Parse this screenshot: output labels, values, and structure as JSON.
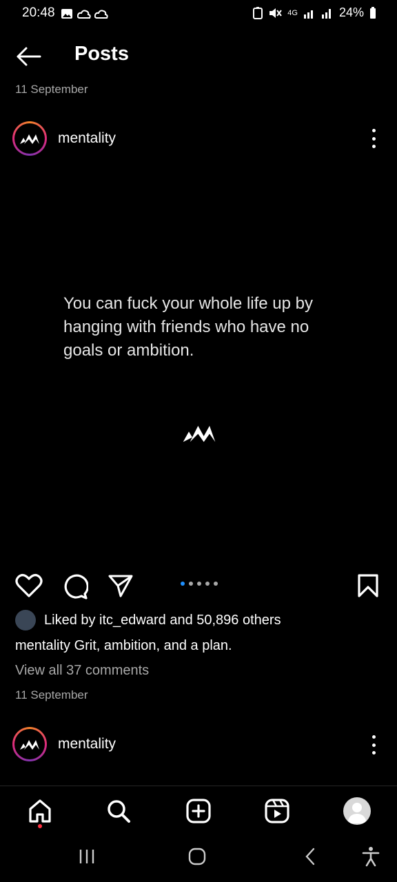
{
  "status_bar": {
    "time": "20:48",
    "network": "4G",
    "battery": "24%",
    "icons": [
      "image-icon",
      "cloud-icon",
      "cloud-icon",
      "battery-saver-icon",
      "mute-icon",
      "signal-icon",
      "signal-icon",
      "battery-icon"
    ]
  },
  "header": {
    "title": "Posts",
    "back_icon": "arrow-left-icon"
  },
  "posts": [
    {
      "date": "11 September",
      "username": "mentality",
      "quote": "You can fuck your whole life up by hanging with friends who have no goals or ambition.",
      "carousel": {
        "count": 5,
        "active_index": 0
      },
      "likes_text": "Liked by itc_edward and 50,896 others",
      "caption_user": "mentality",
      "caption_text": "Grit, ambition, and a plan.",
      "comments_link": "View all 37 comments",
      "footer_date": "11 September"
    },
    {
      "username": "mentality"
    }
  ],
  "bottom_nav": [
    "home-icon",
    "search-icon",
    "create-icon",
    "reels-icon",
    "profile-icon"
  ],
  "system_nav": [
    "recents-icon",
    "home-button-icon",
    "back-icon",
    "accessibility-icon"
  ],
  "colors": {
    "background": "#000000",
    "secondary_text": "#a8a8a8",
    "carousel_active": "#1e90ff",
    "notification_dot": "#ff3040"
  }
}
